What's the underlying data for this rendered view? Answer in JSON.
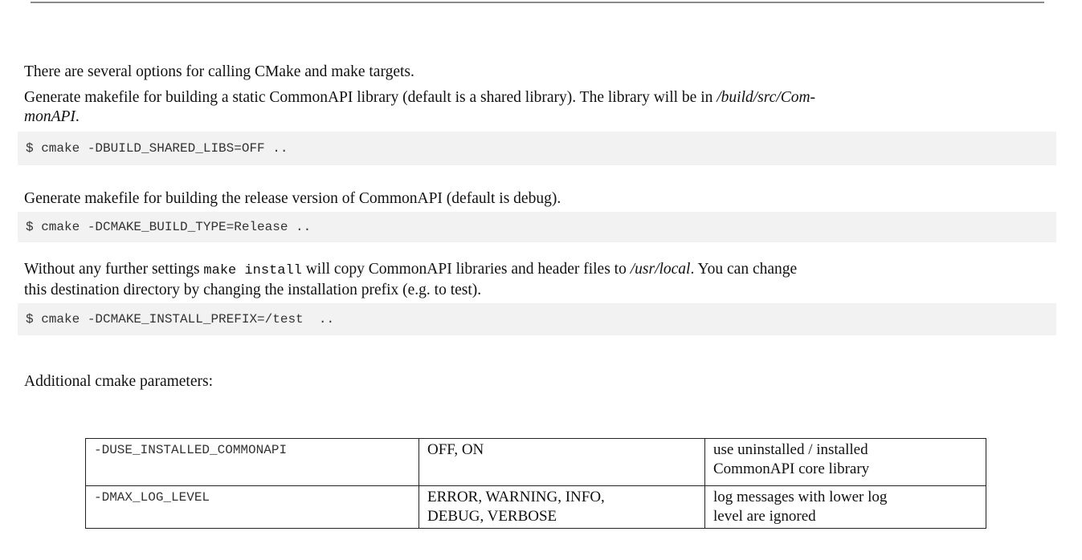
{
  "intro": "There are several options for calling CMake and make targets.",
  "static_lib": {
    "text_before": "Generate makefile for building a static CommonAPI library (default is a shared library). The library will be in ",
    "path_line1": "/build/src/Com-",
    "path_line2": "monAPI",
    "text_after": ".",
    "code": "$ cmake -DBUILD_SHARED_LIBS=OFF .."
  },
  "release": {
    "text": "Generate makefile for building the release version of CommonAPI (default is debug).",
    "code": "$ cmake -DCMAKE_BUILD_TYPE=Release .."
  },
  "install": {
    "text_before": "Without any further settings ",
    "inline_code": "make install",
    "text_mid": " will copy CommonAPI libraries and header files to ",
    "path": "/usr/local",
    "text_after": ". You can change",
    "line2": "this destination directory by changing the installation prefix (e.g. to test).",
    "code": "$ cmake -DCMAKE_INSTALL_PREFIX=/test  .."
  },
  "additional": "Additional cmake parameters:",
  "params_table": [
    {
      "param": "-DUSE_INSTALLED_COMMONAPI",
      "values": "OFF, ON",
      "desc_line1": "use uninstalled / installed",
      "desc_line2": "CommonAPI core library"
    },
    {
      "param": "-DMAX_LOG_LEVEL",
      "values_line1": "ERROR, WARNING, INFO,",
      "values_line2": "DEBUG, VERBOSE",
      "desc_line1": "log messages with lower log",
      "desc_line2": "level are ignored"
    }
  ]
}
